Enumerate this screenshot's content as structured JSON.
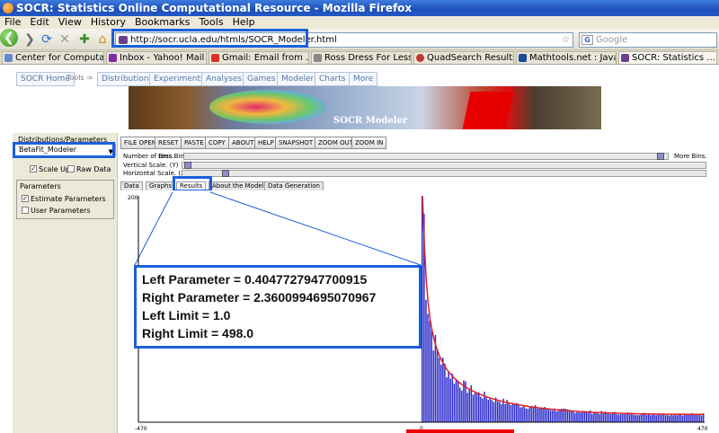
{
  "window": {
    "title": "SOCR: Statistics Online Computational Resource - Mozilla Firefox"
  },
  "menu": [
    "File",
    "Edit",
    "View",
    "History",
    "Bookmarks",
    "Tools",
    "Help"
  ],
  "nav": {
    "url": "http://socr.ucla.edu/htmls/SOCR_Modeler.html",
    "search_placeholder": "Google"
  },
  "tabs": [
    {
      "label": "Center for Computa...",
      "color": "#6688cc"
    },
    {
      "label": "Inbox - Yahoo! Mail",
      "color": "#7b2c9e"
    },
    {
      "label": "Gmail: Email from ...",
      "color": "#d93025"
    },
    {
      "label": "Ross Dress For Less...",
      "color": "#888888"
    },
    {
      "label": "QuadSearch Results...",
      "color": "#c0392b"
    },
    {
      "label": "Mathtools.net : Java...",
      "color": "#1a4b9c"
    },
    {
      "label": "SOCR: Statistics ...",
      "color": "#6b3f8f"
    }
  ],
  "socr_nav": {
    "home": "SOCR Home",
    "tools": "Tools ⇒",
    "items": [
      "Distributions",
      "Experiments",
      "Analyses",
      "Games",
      "Modeler",
      "Charts",
      "More"
    ]
  },
  "banner_text": "SOCR Modeler",
  "left_panel": {
    "section1": "Distributions/Parameters",
    "selected_model": "BetaFit_Modeler",
    "scale_up": "Scale Up",
    "raw_data": "Raw Data",
    "section2": "Parameters",
    "estimate": "Estimate Parameters",
    "user": "User Parameters"
  },
  "toolbar": [
    "FILE OPEN",
    "RESET",
    "PASTE",
    "COPY",
    "ABOUT",
    "HELP",
    "SNAPSHOT",
    "ZOOM OUT",
    "ZOOM IN"
  ],
  "sliders": {
    "bins_label": "Number of Bins.",
    "less_bins": "Less Bins.",
    "more_bins": "More Bins.",
    "vertical": "Vertical Scale. (Y)",
    "horizontal": "Horizontal Scale. (X)"
  },
  "view_tabs": [
    "Data",
    "Graphs",
    "Results",
    "About the Model",
    "Data Generation"
  ],
  "results": {
    "left_param": "Left Parameter = 0.4047727947700915",
    "right_param": "Right Parameter = 2.3600994695070967",
    "left_limit": "Left Limit = 1.0",
    "right_limit": "Right Limit = 498.0"
  },
  "chart_data": {
    "type": "bar",
    "x_ticks": [
      "-470",
      "0",
      "470"
    ],
    "y_ticks": [
      "200"
    ],
    "xlim": [
      -470,
      470
    ],
    "ylim": [
      0,
      200
    ],
    "histogram_color": "#2b2bcc",
    "fit_curve_color": "#e02020"
  }
}
